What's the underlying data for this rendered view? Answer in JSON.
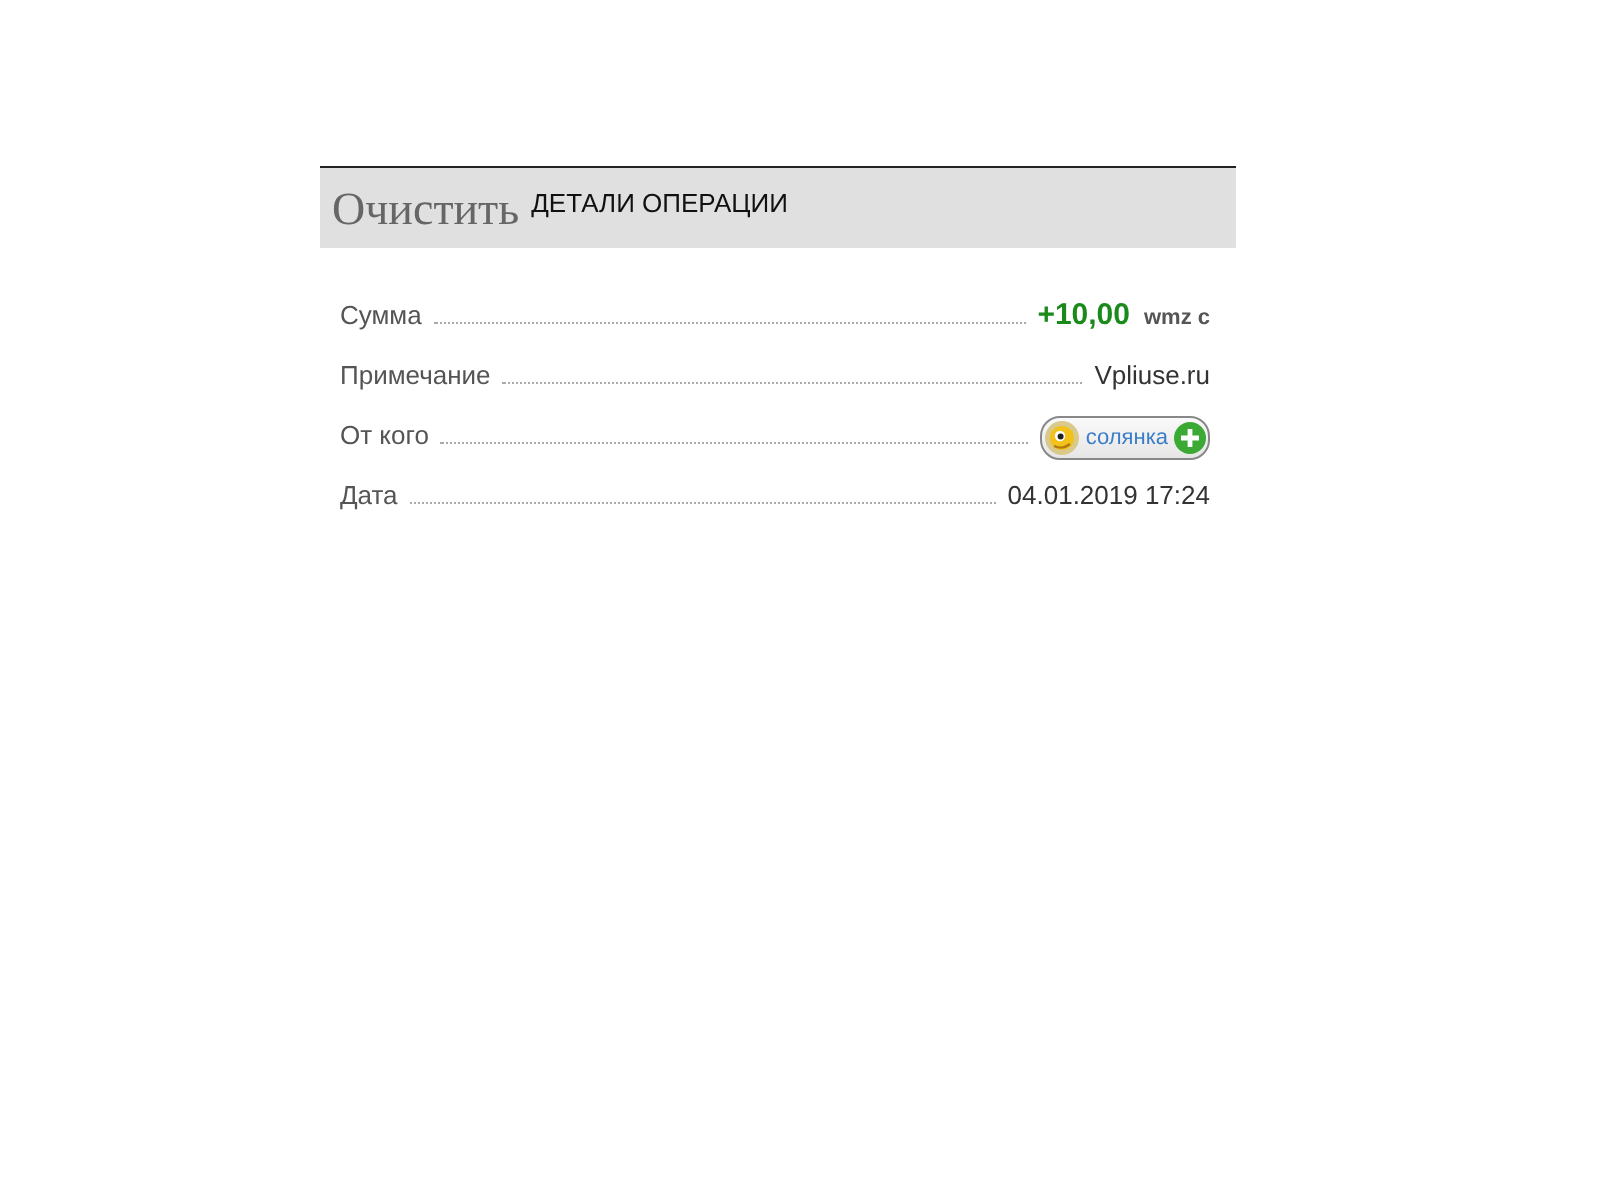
{
  "header": {
    "clear_link": "Очистить",
    "title": "ДЕТАЛИ ОПЕРАЦИИ"
  },
  "rows": [
    {
      "kind": "amount",
      "label": "Сумма",
      "value": "+10,00",
      "currency": "wmz c"
    },
    {
      "kind": "text",
      "label": "Примечание",
      "value": "Vpliuse.ru"
    },
    {
      "kind": "user",
      "label": "От кого",
      "value": "солянка"
    },
    {
      "kind": "text",
      "label": "Дата",
      "value": "04.01.2019 17:24"
    }
  ]
}
